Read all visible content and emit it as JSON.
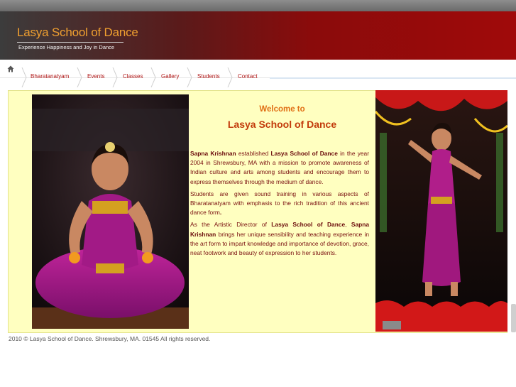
{
  "header": {
    "title": "Lasya School of Dance",
    "tagline": "Experience Happiness and Joy in Dance"
  },
  "nav": {
    "home_icon": "home-icon",
    "items": [
      {
        "label": "Bharatanatyam"
      },
      {
        "label": "Events"
      },
      {
        "label": "Classes"
      },
      {
        "label": "Gallery"
      },
      {
        "label": "Students"
      },
      {
        "label": "Contact"
      }
    ]
  },
  "main": {
    "welcome": "Welcome to",
    "school_name": "Lasya School of Dance",
    "p1": {
      "name": "Sapna Krishnan",
      "text1": " established ",
      "school": "Lasya School of Dance",
      "text2": " in the year 2004 in Shrewsbury, MA with a mission to promote awareness of Indian culture and arts among students and encourage them to express themselves through the medium of dance."
    },
    "p2": {
      "text": "Students are given sound training in various aspects of Bharatanatyam with emphasis to the rich tradition of this ancient dance form",
      "end": "."
    },
    "p3": {
      "text1": "As the Artistic Director of ",
      "school": "Lasya School of Dance",
      "comma": ", ",
      "name": "Sapna Krishnan",
      "text2": " brings her unique sensibility and teaching experience in the art form to impart knowledge and importance of devotion, grace, neat footwork and beauty of expression to her students."
    }
  },
  "footer": {
    "text": "2010 © Lasya School of Dance. Shrewsbury, MA. 01545  All rights reserved."
  },
  "colors": {
    "header_red": "#a00a0a",
    "title_orange": "#f0a030",
    "nav_link": "#b01515",
    "content_bg": "#ffffc0",
    "body_text": "#7a1010"
  }
}
